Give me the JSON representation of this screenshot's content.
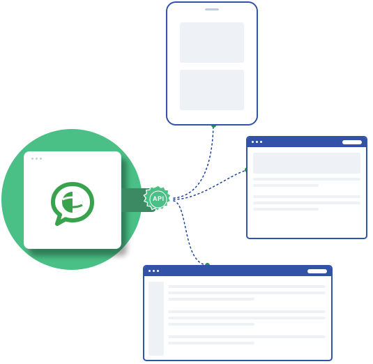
{
  "api": {
    "label": "API"
  },
  "colors": {
    "brand_green": "#4ABF86",
    "brand_green_dark": "#23944F",
    "accent_blue": "#3252A8",
    "neutral_fill": "#EEF2F7"
  }
}
